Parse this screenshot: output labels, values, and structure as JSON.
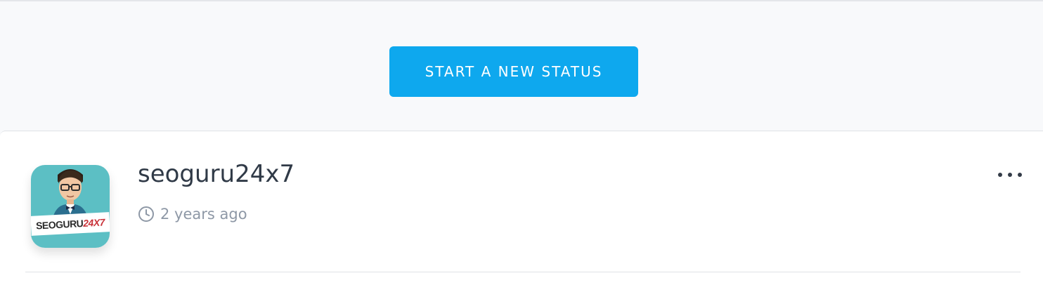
{
  "actions": {
    "new_status_label": "START A NEW STATUS"
  },
  "post": {
    "username": "seoguru24x7",
    "timestamp": "2 years ago",
    "avatar": {
      "brand_text": "SEOGURU",
      "brand_accent": "24X7"
    }
  },
  "icons": {
    "clock": "clock-icon",
    "more": "more-horizontal-icon"
  },
  "colors": {
    "accent": "#0ea8ee",
    "username": "#303a47",
    "meta": "#8e98a6"
  }
}
